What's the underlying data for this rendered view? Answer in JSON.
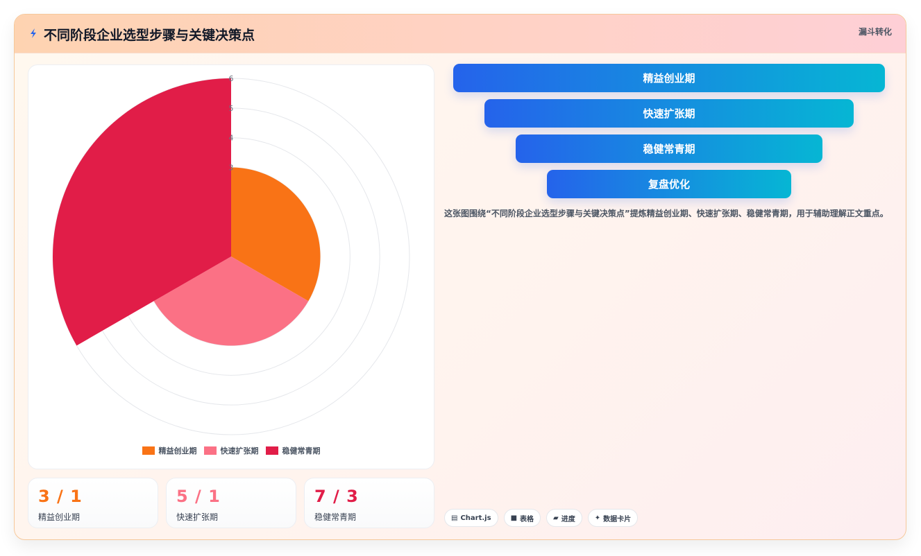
{
  "header": {
    "title": "不同阶段企业选型步骤与关键决策点",
    "badge": "漏斗转化",
    "icon": "lightning-icon"
  },
  "chart_data": {
    "type": "polarArea",
    "categories": [
      "精益创业期",
      "快速扩张期",
      "稳健常青期"
    ],
    "values": [
      3,
      3,
      6
    ],
    "radial_ticks": [
      3,
      4,
      5,
      6
    ],
    "rmax": 6,
    "colors": [
      "#f97316",
      "#fb7185",
      "#e11d48"
    ],
    "legend_position": "bottom"
  },
  "stats": [
    {
      "value": "3 / 1",
      "label": "精益创业期",
      "color": "#f97316"
    },
    {
      "value": "5 / 1",
      "label": "快速扩张期",
      "color": "#fb7185"
    },
    {
      "value": "7 / 3",
      "label": "稳健常青期",
      "color": "#e11d48"
    }
  ],
  "funnel": [
    "精益创业期",
    "快速扩张期",
    "稳健常青期",
    "复盘优化"
  ],
  "description": "这张图围绕“不同阶段企业选型步骤与关键决策点”提炼精益创业期、快速扩张期、稳健常青期，用于辅助理解正文重点。",
  "tags": [
    {
      "icon": "chart-icon",
      "glyph": "▤",
      "label": "Chart.js"
    },
    {
      "icon": "table-icon",
      "glyph": "■",
      "label": "表格"
    },
    {
      "icon": "progress-icon",
      "glyph": "▰",
      "label": "进度"
    },
    {
      "icon": "data-card-icon",
      "glyph": "✦",
      "label": "数据卡片"
    }
  ]
}
